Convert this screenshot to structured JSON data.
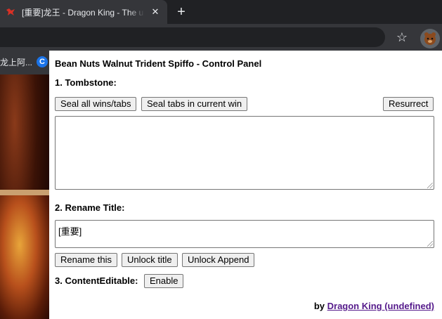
{
  "browser": {
    "tab_title": "[重要]龙王 - Dragon King - The u",
    "close_glyph": "✕",
    "new_tab_glyph": "+",
    "star_glyph": "☆",
    "bookmark_text": "龙上阿...",
    "bookmark_icon_letter": "C"
  },
  "panel": {
    "title": "Bean Nuts Walnut Trident Spiffo - Control Panel",
    "tombstone": {
      "label": "1. Tombstone:",
      "seal_all": "Seal all wins/tabs",
      "seal_current": "Seal tabs in current win",
      "resurrect": "Resurrect",
      "textarea_value": ""
    },
    "rename": {
      "label": "2. Rename Title:",
      "textarea_value": "[重要]",
      "rename_this": "Rename this",
      "unlock_title": "Unlock title",
      "unlock_append": "Unlock Append"
    },
    "contenteditable": {
      "label": "3. ContentEditable:",
      "enable": "Enable"
    },
    "footer": {
      "by": "by",
      "author": "Dragon King (undefined)"
    }
  },
  "colors": {
    "link_visited": "#551a8b",
    "tab_active": "#35363a",
    "tabstrip": "#202124"
  }
}
